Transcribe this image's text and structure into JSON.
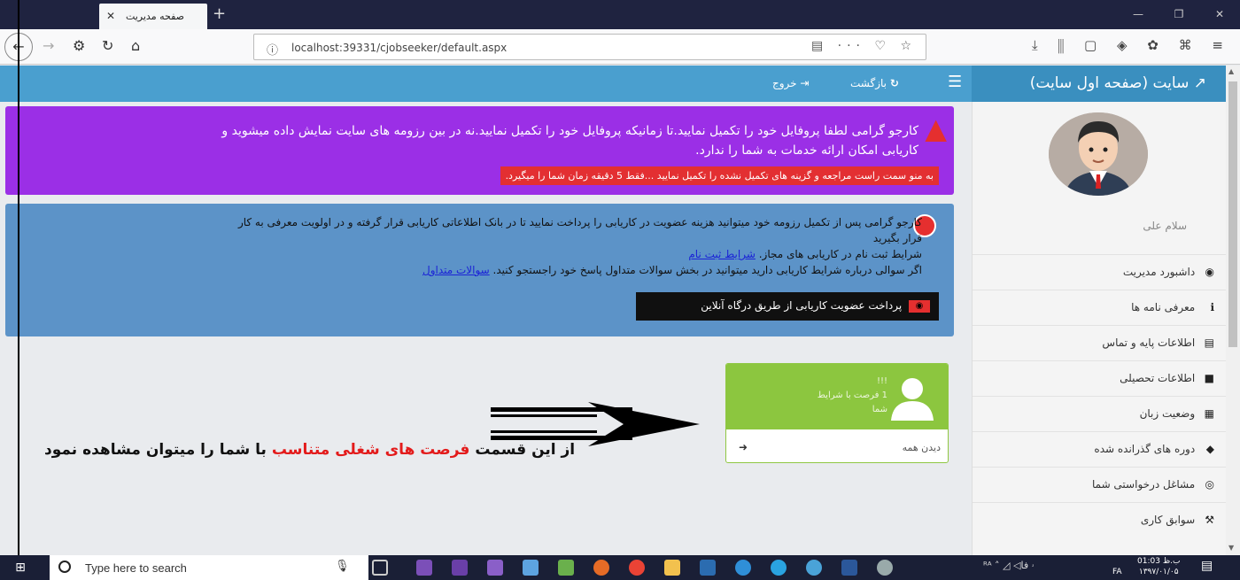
{
  "browser": {
    "tab_title": "صفحه مدیریت",
    "tab_close": "✕",
    "new_tab": "+",
    "url": "localhost:39331/cjobseeker/default.aspx",
    "url_info": "ⓘ",
    "url_icons": "▤ ··· ♡ ☆",
    "window_controls": [
      "—",
      "❐",
      "✕"
    ],
    "toolbar_icons": "⤓ ⫼ ▢ ◈ ✿ ⌘ ≡"
  },
  "topbar": {
    "back_label": "بازگشت",
    "logout_label": "خروج",
    "brand": "سایت (صفحه اول سایت)"
  },
  "sidebar": {
    "username": "سلام علی",
    "items": [
      {
        "icon": "dashboard-icon",
        "glyph": "◉",
        "label": "داشبورد مدیریت"
      },
      {
        "icon": "info-icon",
        "glyph": "ℹ",
        "label": "معرفی نامه ها"
      },
      {
        "icon": "contact-card-icon",
        "glyph": "▤",
        "label": "اطلاعات پایه و تماس"
      },
      {
        "icon": "briefcase-icon",
        "glyph": "■",
        "label": "اطلاعات تحصیلی"
      },
      {
        "icon": "language-icon",
        "glyph": "▦",
        "label": "وضعیت زبان"
      },
      {
        "icon": "graduation-cap-icon",
        "glyph": "◆",
        "label": "دوره های گذرانده شده"
      },
      {
        "icon": "handshake-icon",
        "glyph": "◎",
        "label": "مشاغل درخواستی شما"
      },
      {
        "icon": "gavel-icon",
        "glyph": "⚒",
        "label": "سوابق کاری"
      }
    ]
  },
  "alert_profile": {
    "line1": "کارجو گرامی لطفا پروفایل خود را تکمیل نمایید.تا زمانیکه پروفایل خود را تکمیل نمایید.نه در بین رزومه های سایت نمایش داده میشوید و",
    "line2": "کاریابی امکان ارائه خدمات به شما را ندارد.",
    "highlight": "به منو سمت راست مراجعه و گزینه های تکمیل نشده را تکمیل نمایید ...فقط 5 دقیقه زمان شما را میگیرد."
  },
  "alert_membership": {
    "line1": "کارجو گرامی پس از تکمیل رزومه خود میتوانید هزینه عضویت در کاریابی را پرداخت نمایید تا در بانک اطلاعاتی کاریابی قرار گرفته و در اولویت معرفی به کار",
    "line2": "قرار بگیرید",
    "line3_text": "شرایط ثبت نام در کاریابی های مجاز.",
    "line3_link": "شرایط ثبت نام",
    "line4_text": "اگر سوالی درباره شرایط کاریابی دارید میتوانید در بخش سوالات متداول پاسخ خود راجستجو کنید.",
    "line4_link": "سوالات متداول",
    "pay_button": "پرداخت عضویت کاریابی از طریق درگاه آنلاین"
  },
  "job_card": {
    "count": "!!!",
    "line1": "1 فرصت با شرایط",
    "line2": "شما",
    "footer": "دیدن همه"
  },
  "annotation": {
    "part1": "از این قسمت",
    "part2": "فرصت های شغلی متناسب",
    "part3": "با شما را میتوان مشاهده نمود"
  },
  "taskbar": {
    "search_placeholder": "Type here to search",
    "lang": "FA",
    "time": "01:03 ب.ظ",
    "date": "۱۳۹۷/۰۱/۰۵",
    "tray_icons": "ᴿᴬ ˄ ◿ ◁ۥ فا"
  },
  "colors": {
    "brand": "#4a9fcf",
    "alert_purple": "#9b2fe6",
    "alert_blue": "#5c93c8",
    "card_green": "#8cc63f",
    "danger": "#e52f2f"
  }
}
